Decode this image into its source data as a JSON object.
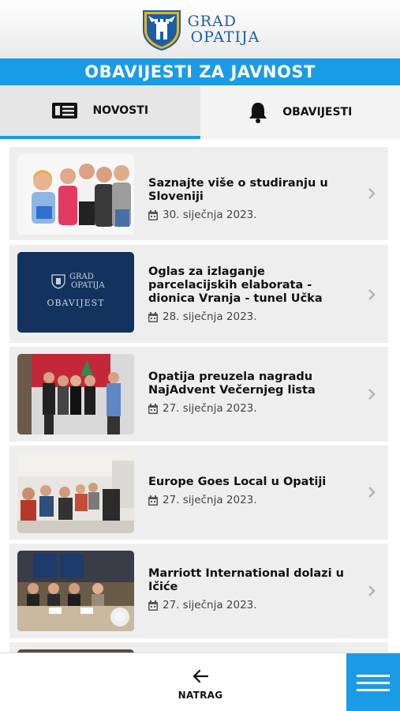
{
  "header": {
    "logo_line1": "GRAD",
    "logo_line2": "OPATIJA"
  },
  "page_title": "OBAVIJESTI ZA JAVNOST",
  "tabs": [
    {
      "label": "NOVOSTI",
      "icon": "news-icon",
      "active": true
    },
    {
      "label": "OBAVIJESTI",
      "icon": "bell-icon",
      "active": false
    }
  ],
  "news": [
    {
      "title": "Saznajte više o studiranju u Sloveniji",
      "date": "30. siječnja 2023."
    },
    {
      "title": "Oglas za izlaganje parcelacijskih elaborata - dionica Vranja - tunel Učka",
      "date": "28. siječnja 2023.",
      "thumb_line1": "GRAD",
      "thumb_line2": "OPATIJA",
      "thumb_caption": "OBAVIJEST"
    },
    {
      "title": "Opatija preuzela nagradu NajAdvent Večernjeg lista",
      "date": "27. siječnja 2023."
    },
    {
      "title": "Europe Goes Local u Opatiji",
      "date": "27. siječnja 2023."
    },
    {
      "title": "Marriott International dolazi u Ičiće",
      "date": "27. siječnja 2023."
    }
  ],
  "footer": {
    "back_label": "NATRAG"
  },
  "colors": {
    "accent": "#1a9be6",
    "logo": "#1b5ea6",
    "card_bg": "#eeeeee"
  }
}
